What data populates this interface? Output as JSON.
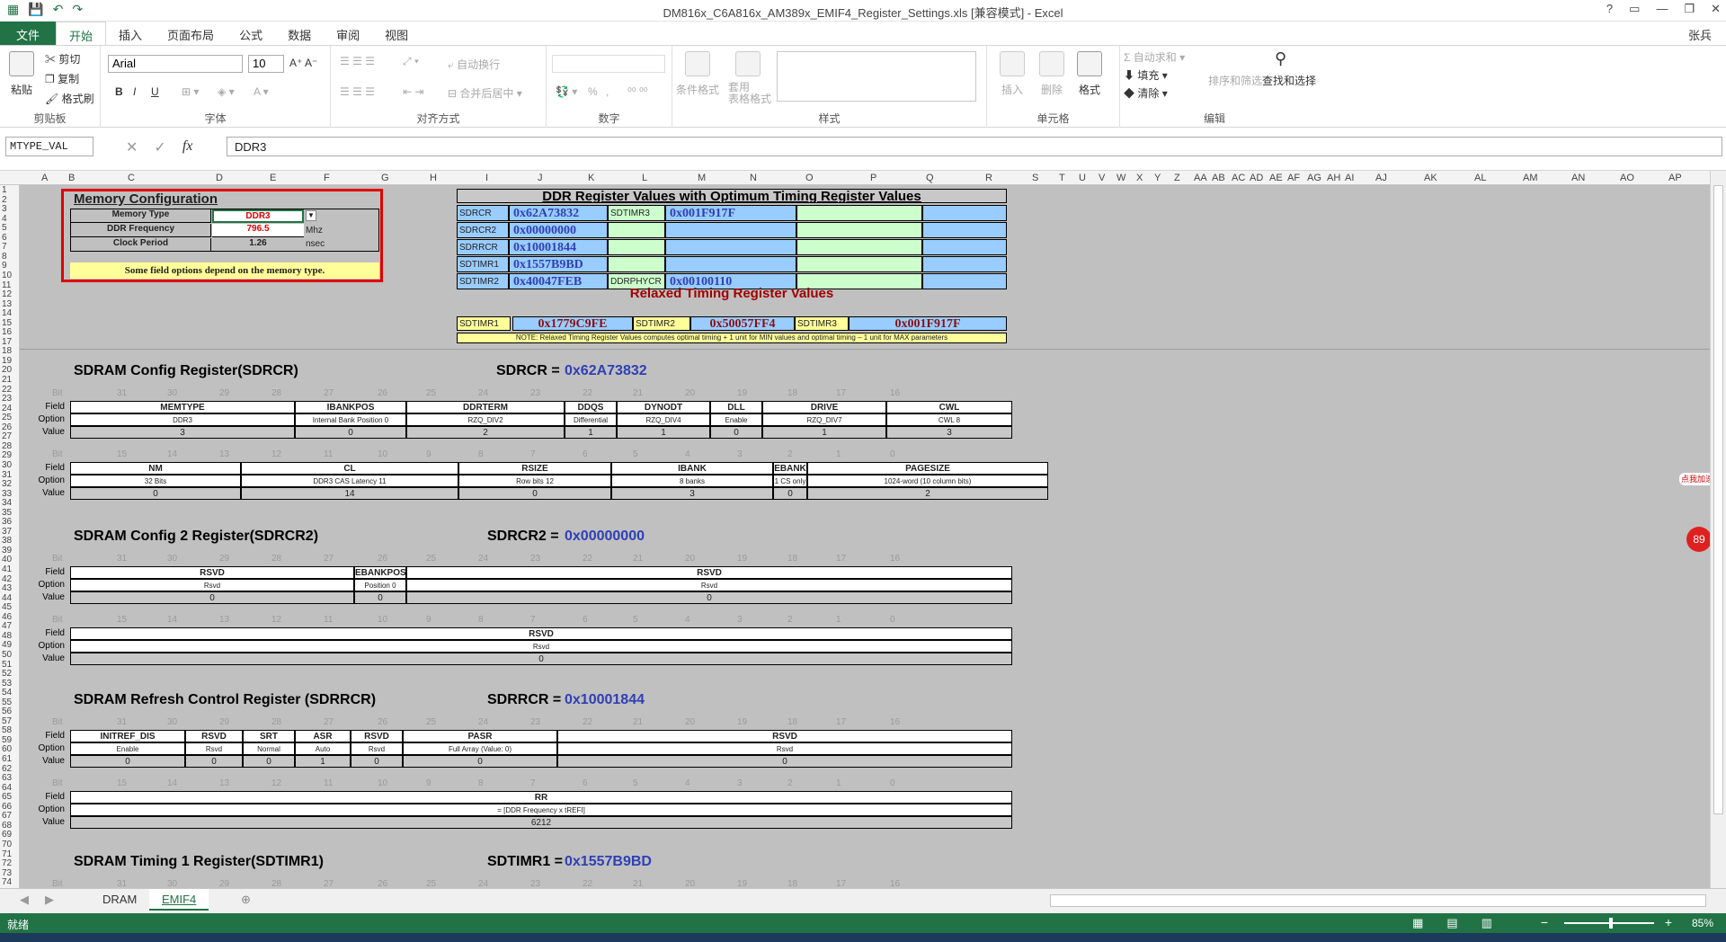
{
  "window": {
    "title": "DM816x_C6A816x_AM389x_EMIF4_Register_Settings.xls  [兼容模式] - Excel",
    "controls": [
      "?",
      "▭",
      "—",
      "❐",
      "✕"
    ]
  },
  "ribbon": {
    "file_tab": "文件",
    "tabs": [
      "开始",
      "插入",
      "页面布局",
      "公式",
      "数据",
      "审阅",
      "视图"
    ],
    "user": "张兵",
    "clipboard": {
      "paste": "粘贴",
      "cut": "剪切",
      "copy": "复制",
      "format_painter": "格式刷",
      "label": "剪贴板"
    },
    "font": {
      "name": "Arial",
      "size": "10",
      "label": "字体",
      "bold": "B",
      "italic": "I",
      "underline": "U"
    },
    "alignment": {
      "wrap": "自动换行",
      "merge": "合并后居中",
      "label": "对齐方式"
    },
    "number": {
      "label": "数字",
      "percent": "%"
    },
    "styles": {
      "conditional": "条件格式",
      "table": "套用\n表格格式",
      "label": "样式"
    },
    "cells": {
      "insert": "插入",
      "delete": "删除",
      "format": "格式",
      "label": "单元格"
    },
    "editing": {
      "autosum": "自动求和",
      "fill": "填充",
      "clear": "清除",
      "sort": "排序和筛选",
      "find": "查找和选择",
      "label": "编辑"
    }
  },
  "formula_bar": {
    "name_box": "MTYPE_VAL",
    "fx": "fx",
    "value": "DDR3"
  },
  "columns": [
    "A",
    "B",
    "C",
    "D",
    "E",
    "F",
    "G",
    "H",
    "I",
    "J",
    "K",
    "L",
    "M",
    "N",
    "O",
    "P",
    "Q",
    "R",
    "S",
    "T",
    "U",
    "V",
    "W",
    "X",
    "Y",
    "Z",
    "AA",
    "AB",
    "AC",
    "AD",
    "AE",
    "AF",
    "AG",
    "AH",
    "AI",
    "AJ",
    "AK",
    "AL",
    "AM",
    "AN",
    "AO",
    "AP"
  ],
  "rows": [
    "1",
    "2",
    "3",
    "4",
    "5",
    "6",
    "7",
    "8",
    "9",
    "10",
    "11",
    "12",
    "13",
    "14",
    "15",
    "16",
    "17",
    "18",
    "19",
    "20",
    "21",
    "22",
    "23",
    "24",
    "25",
    "26",
    "27",
    "28",
    "29",
    "30",
    "31",
    "32",
    "33",
    "34",
    "35",
    "36",
    "37",
    "38",
    "39",
    "40",
    "41",
    "42",
    "43",
    "44",
    "45",
    "46",
    "47",
    "48",
    "49",
    "50",
    "51",
    "52",
    "53",
    "54",
    "55",
    "56",
    "57",
    "58",
    "59",
    "60",
    "61",
    "62",
    "63",
    "64",
    "65",
    "66",
    "67",
    "68",
    "69",
    "70",
    "71",
    "72",
    "73",
    "74"
  ],
  "memory_config": {
    "title": "Memory Configuration",
    "memory_type_label": "Memory Type",
    "memory_type_value": "DDR3",
    "ddr_freq_label": "DDR Frequency",
    "ddr_freq_value": "796.5",
    "ddr_freq_unit": "Mhz",
    "clock_period_label": "Clock Period",
    "clock_period_value": "1.26",
    "clock_period_unit": "nsec",
    "note": "Some field options depend on the memory type."
  },
  "ddr_values": {
    "title": "DDR Register Values with Optimum Timing Register Values",
    "rows": [
      {
        "n1": "SDRCR",
        "v1": "0x62A73832",
        "n2": "SDTIMR3",
        "v2": "0x001F917F"
      },
      {
        "n1": "SDRCR2",
        "v1": "0x00000000",
        "n2": "",
        "v2": ""
      },
      {
        "n1": "SDRRCR",
        "v1": "0x10001844",
        "n2": "",
        "v2": ""
      },
      {
        "n1": "SDTIMR1",
        "v1": "0x1557B9BD",
        "n2": "",
        "v2": ""
      },
      {
        "n1": "SDTIMR2",
        "v1": "0x40047FEB",
        "n2": "DDRPHYCR",
        "v2": "0x00100110"
      }
    ],
    "relaxed_title": "Relaxed Timing Register Values",
    "relaxed": [
      {
        "n": "SDTIMR1",
        "v": "0x1779C9FE"
      },
      {
        "n": "SDTIMR2",
        "v": "0x50057FF4"
      },
      {
        "n": "SDTIMR3",
        "v": "0x001F917F"
      }
    ],
    "note": "NOTE: Relaxed Timing Register Values computes optimal timing + 1 unit for MIN values and optimal timing – 1 unit for MAX parameters"
  },
  "labels": {
    "bit": "Bit",
    "field": "Field",
    "option": "Option",
    "value": "Value"
  },
  "bits_high": [
    "31",
    "30",
    "29",
    "28",
    "27",
    "26",
    "25",
    "24",
    "23",
    "22",
    "21",
    "20",
    "19",
    "18",
    "17",
    "16"
  ],
  "bits_low": [
    "15",
    "14",
    "13",
    "12",
    "11",
    "10",
    "9",
    "8",
    "7",
    "6",
    "5",
    "4",
    "3",
    "2",
    "1",
    "0"
  ],
  "sdrcr": {
    "title": "SDRAM Config Register(SDRCR)",
    "reg": "SDRCR =",
    "hex": "0x62A73832",
    "high": [
      {
        "f": "MEMTYPE",
        "o": "DDR3",
        "v": "3"
      },
      {
        "f": "IBANKPOS",
        "o": "Internal Bank Position 0",
        "v": "0"
      },
      {
        "f": "DDRTERM",
        "o": "RZQ_DIV2",
        "v": "2"
      },
      {
        "f": "DDQS",
        "o": "Differential",
        "v": "1"
      },
      {
        "f": "DYNODT",
        "o": "RZQ_DIV4",
        "v": "1"
      },
      {
        "f": "DLL",
        "o": "Enable",
        "v": "0"
      },
      {
        "f": "DRIVE",
        "o": "RZQ_DIV7",
        "v": "1"
      },
      {
        "f": "CWL",
        "o": "CWL 8",
        "v": "3"
      }
    ],
    "low": [
      {
        "f": "NM",
        "o": "32 Bits",
        "v": "0"
      },
      {
        "f": "CL",
        "o": "DDR3 CAS Latency 11",
        "v": "14"
      },
      {
        "f": "RSIZE",
        "o": "Row bits 12",
        "v": "0"
      },
      {
        "f": "IBANK",
        "o": "8 banks",
        "v": "3"
      },
      {
        "f": "EBANK",
        "o": "1 CS only",
        "v": "0"
      },
      {
        "f": "PAGESIZE",
        "o": "1024-word (10 column bits)",
        "v": "2"
      }
    ]
  },
  "sdrcr2": {
    "title": "SDRAM Config 2 Register(SDRCR2)",
    "reg": "SDRCR2 =",
    "hex": "0x00000000",
    "high": [
      {
        "f": "RSVD",
        "o": "Rsvd",
        "v": "0"
      },
      {
        "f": "EBANKPOS",
        "o": "Position 0",
        "v": "0"
      },
      {
        "f": "RSVD",
        "o": "Rsvd",
        "v": "0"
      }
    ],
    "low": [
      {
        "f": "RSVD",
        "o": "Rsvd",
        "v": "0"
      }
    ]
  },
  "sdrrcr": {
    "title": "SDRAM Refresh Control Register (SDRRCR)",
    "reg": "SDRRCR =",
    "hex": "0x10001844",
    "high": [
      {
        "f": "INITREF_DIS",
        "o": "Enable",
        "v": "0"
      },
      {
        "f": "RSVD",
        "o": "Rsvd",
        "v": "0"
      },
      {
        "f": "SRT",
        "o": "Normal",
        "v": "0"
      },
      {
        "f": "ASR",
        "o": "Auto",
        "v": "1"
      },
      {
        "f": "RSVD",
        "o": "Rsvd",
        "v": "0"
      },
      {
        "f": "PASR",
        "o": "Full Array (Value: 0)",
        "v": "0"
      },
      {
        "f": "RSVD",
        "o": "Rsvd",
        "v": "0"
      }
    ],
    "low": [
      {
        "f": "RR",
        "o": "= [DDR Frequency x tREFI]",
        "v": "6212"
      }
    ]
  },
  "sdtimr1": {
    "title": "SDRAM Timing 1 Register(SDTIMR1)",
    "reg": "SDTIMR1 =",
    "hex": "0x1557B9BD"
  },
  "sheet_tabs": [
    "DRAM",
    "EMIF4"
  ],
  "status": {
    "ready": "就绪",
    "zoom": "85%"
  },
  "colors": {
    "excel_green": "#217346",
    "blue_cell": "#99ccff",
    "green_cell": "#ccffcc",
    "yellow_cell": "#ffff99",
    "red_border": "#e00000"
  }
}
